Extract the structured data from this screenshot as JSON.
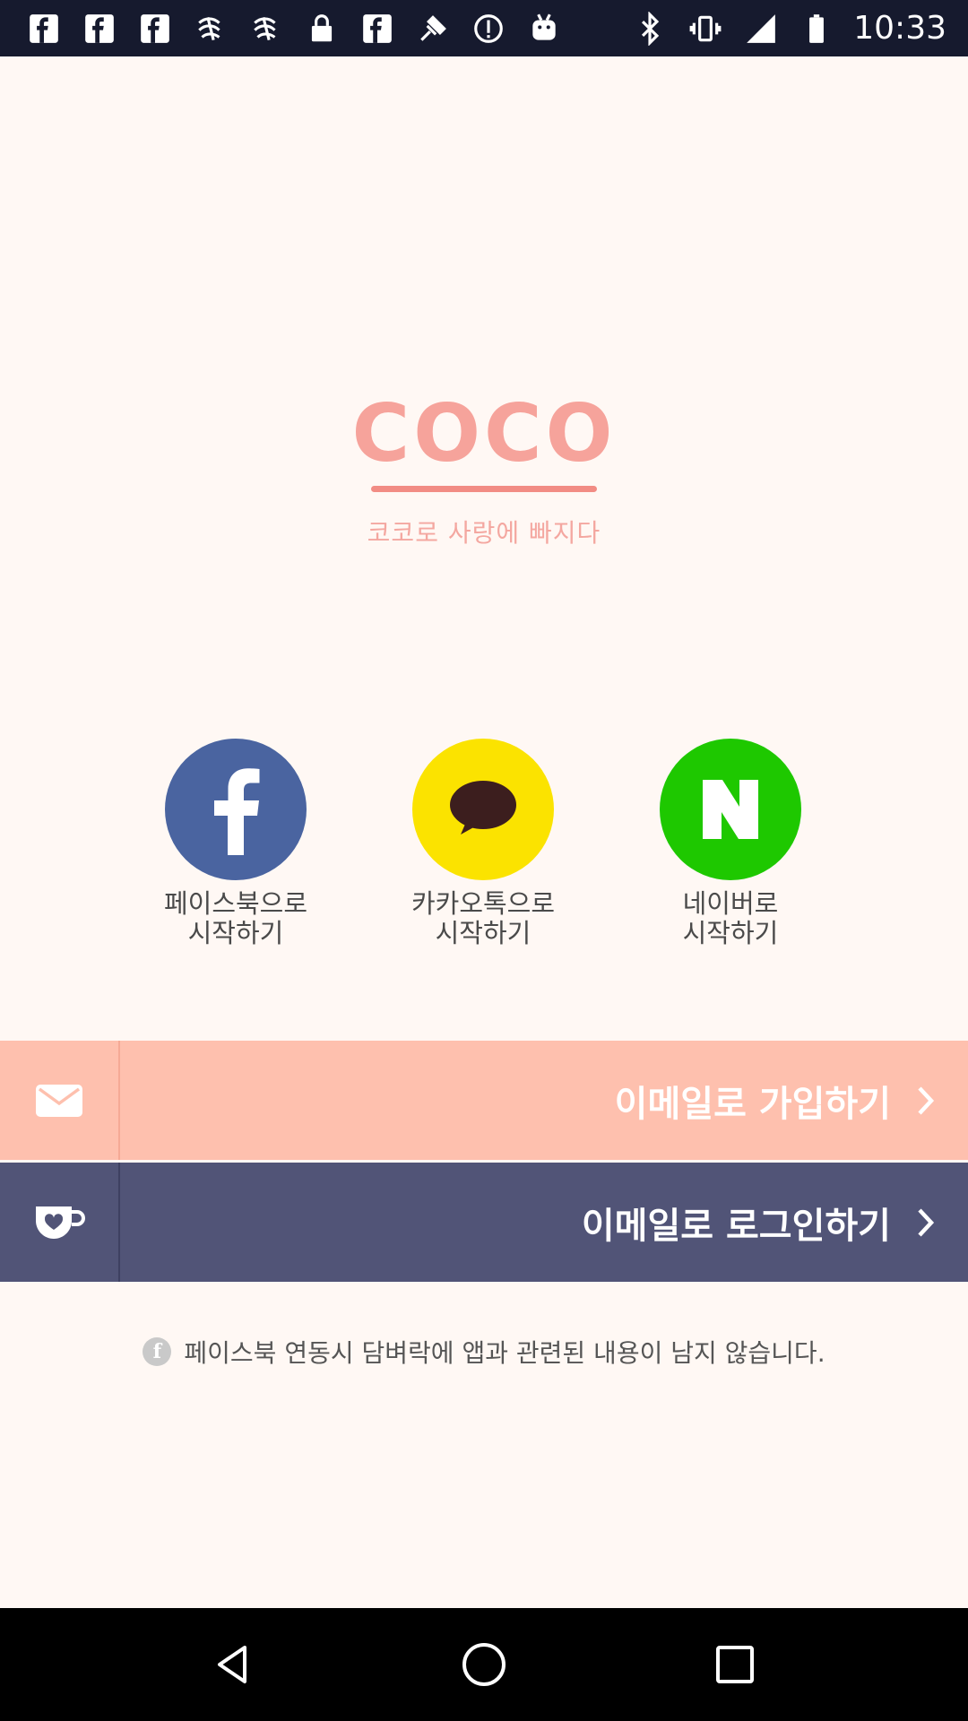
{
  "status_bar": {
    "left_icons": [
      "facebook-icon",
      "facebook-icon",
      "facebook-icon",
      "swirl-icon",
      "swirl-icon",
      "lock-icon",
      "facebook-icon",
      "satellite-icon",
      "info-icon",
      "android-icon"
    ],
    "right_icons": [
      "bluetooth-icon",
      "vibrate-icon",
      "signal-icon",
      "battery-icon"
    ],
    "time": "10:33"
  },
  "logo": {
    "word": "COCO",
    "tagline": "코코로 사랑에 빠지다",
    "color": "#f6a39b"
  },
  "social": [
    {
      "label": "페이스북으로\n시작하기",
      "icon": "facebook-icon",
      "color": "#4a64a0"
    },
    {
      "label": "카카오톡으로\n시작하기",
      "icon": "kakaotalk-icon",
      "color": "#fbe300"
    },
    {
      "label": "네이버로\n시작하기",
      "icon": "naver-icon",
      "color": "#1ec800"
    }
  ],
  "actions": {
    "signup": {
      "label": "이메일로 가입하기",
      "icon": "mail-icon",
      "color": "#fec0ae"
    },
    "login": {
      "label": "이메일로 로그인하기",
      "icon": "cup-heart-icon",
      "color": "#515477"
    }
  },
  "notice": {
    "text": "페이스북 연동시 담벼락에 앱과 관련된 내용이 남지 않습니다.",
    "icon": "facebook-info-icon"
  },
  "nav": {
    "buttons": [
      "back-icon",
      "home-icon",
      "recents-icon"
    ]
  }
}
